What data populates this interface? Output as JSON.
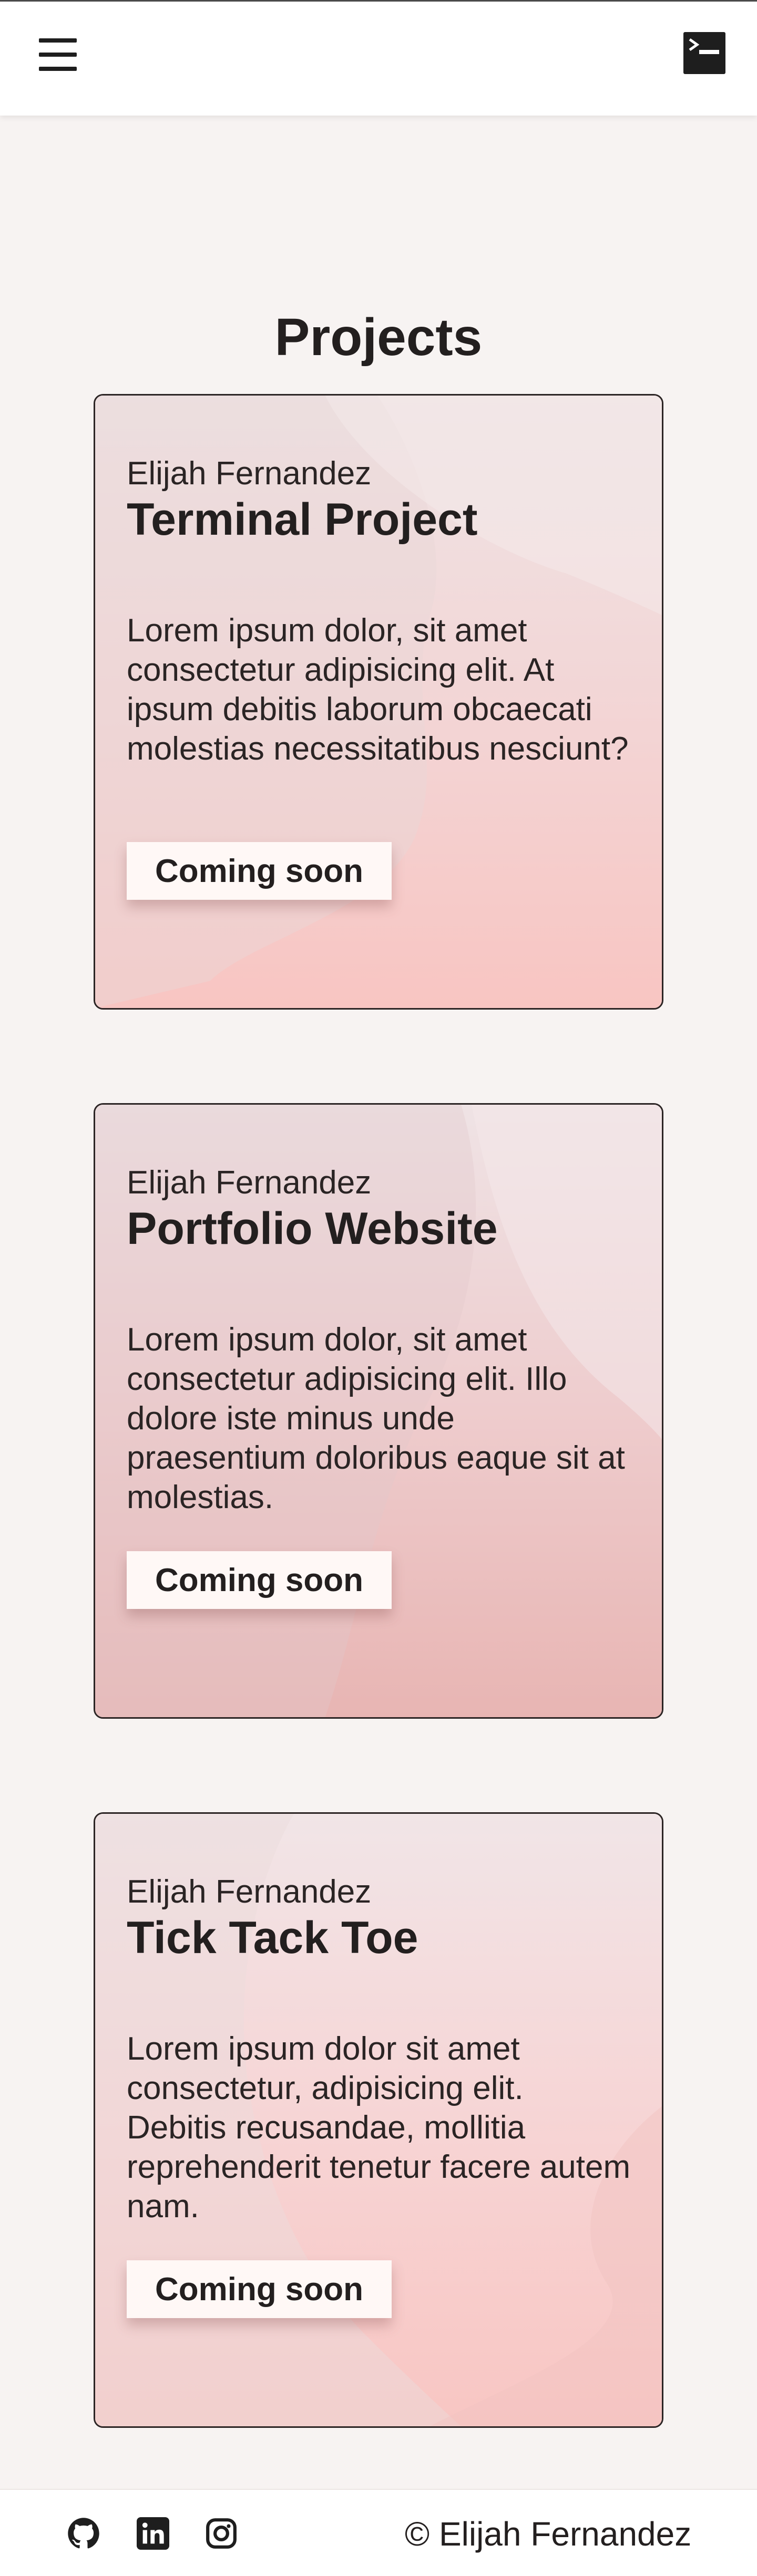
{
  "header": {
    "menu_icon": "hamburger-menu-icon",
    "logo_icon": "terminal-logo-icon"
  },
  "main": {
    "title": "Projects",
    "projects": [
      {
        "author": "Elijah Fernandez",
        "title": "Terminal Project",
        "description": "Lorem ipsum dolor, sit amet consectetur adipisicing elit. At ipsum debitis laborum obcaecati molestias necessitatibus nesciunt?",
        "button": "Coming soon"
      },
      {
        "author": "Elijah Fernandez",
        "title": "Portfolio Website",
        "description": "Lorem ipsum dolor, sit amet consectetur adipisicing elit. Illo dolore iste minus unde praesentium doloribus eaque sit at molestias.",
        "button": "Coming soon"
      },
      {
        "author": "Elijah Fernandez",
        "title": "Tick Tack Toe",
        "description": "Lorem ipsum dolor sit amet consectetur, adipisicing elit. Debitis recusandae, mollitia reprehenderit tenetur facere autem nam.",
        "button": "Coming soon"
      }
    ]
  },
  "footer": {
    "social_icons": [
      "github-icon",
      "linkedin-icon",
      "instagram-icon"
    ],
    "copyright": "© Elijah Fernandez"
  },
  "colors": {
    "background": "#f7f3f2",
    "card_gradient_top": "#eee3e4",
    "card_gradient_bottom": "#f8c6c4",
    "text": "#231f1f"
  }
}
